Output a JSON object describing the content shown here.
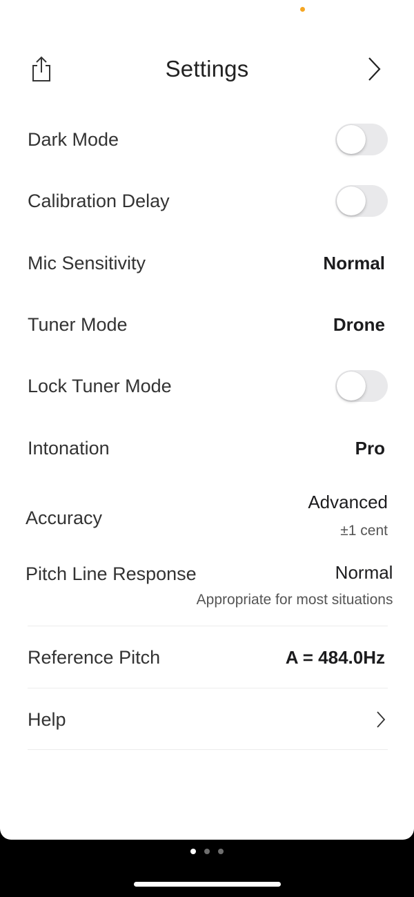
{
  "header": {
    "title": "Settings",
    "share_icon": "share-icon",
    "next_icon": "chevron-right-icon"
  },
  "settings": {
    "dark_mode": {
      "label": "Dark Mode",
      "enabled": false
    },
    "calibration_delay": {
      "label": "Calibration Delay",
      "enabled": false
    },
    "mic_sensitivity": {
      "label": "Mic Sensitivity",
      "value": "Normal"
    },
    "tuner_mode": {
      "label": "Tuner Mode",
      "value": "Drone"
    },
    "lock_tuner_mode": {
      "label": "Lock Tuner Mode",
      "enabled": false
    },
    "intonation": {
      "label": "Intonation",
      "value": "Pro"
    },
    "accuracy": {
      "label": "Accuracy",
      "value": "Advanced",
      "detail": "±1 cent"
    },
    "pitch_line_response": {
      "label": "Pitch Line Response",
      "value": "Normal",
      "detail": "Appropriate for most situations"
    },
    "reference_pitch": {
      "label": "Reference Pitch",
      "value": "A = 484.0Hz"
    },
    "help": {
      "label": "Help",
      "icon": "chevron-right-icon"
    }
  },
  "pager": {
    "count": 3,
    "active_index": 0
  },
  "colors": {
    "accent_dot": "#f5a623",
    "toggle_off": "#e9e9eb",
    "background": "#ffffff"
  }
}
